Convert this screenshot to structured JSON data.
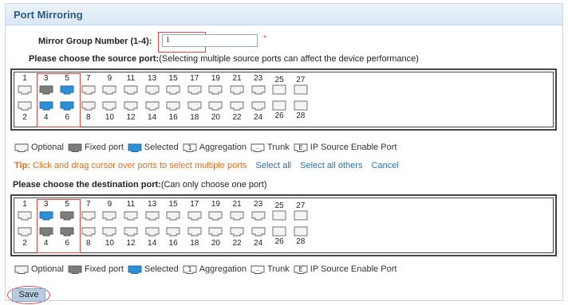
{
  "title": "Port Mirroring",
  "mirror_group": {
    "label": "Mirror Group Number (1-4):",
    "value": "1",
    "required_mark": "*"
  },
  "source": {
    "heading": "Please choose the source port:",
    "note": "(Selecting multiple source ports can affect the device performance)",
    "top_numbers": [
      "1",
      "3",
      "5",
      "7",
      "9",
      "11",
      "13",
      "15",
      "17",
      "19",
      "21",
      "23",
      "25",
      "27"
    ],
    "bottom_numbers": [
      "2",
      "4",
      "6",
      "8",
      "10",
      "12",
      "14",
      "16",
      "18",
      "20",
      "22",
      "24",
      "26",
      "28"
    ],
    "top_states": [
      "optional",
      "fixed",
      "selected",
      "optional",
      "optional",
      "optional",
      "optional",
      "optional",
      "optional",
      "optional",
      "optional",
      "optional",
      "blank",
      "blank"
    ],
    "bottom_states": [
      "optional",
      "selected",
      "selected",
      "optional",
      "optional",
      "optional",
      "optional",
      "optional",
      "optional",
      "optional",
      "optional",
      "optional",
      "blank",
      "blank"
    ]
  },
  "destination": {
    "heading": "Please choose the destination port:",
    "note": "(Can only choose one port)",
    "top_numbers": [
      "1",
      "3",
      "5",
      "7",
      "9",
      "11",
      "13",
      "15",
      "17",
      "19",
      "21",
      "23",
      "25",
      "27"
    ],
    "bottom_numbers": [
      "2",
      "4",
      "6",
      "8",
      "10",
      "12",
      "14",
      "16",
      "18",
      "20",
      "22",
      "24",
      "26",
      "28"
    ],
    "top_states": [
      "optional",
      "selected",
      "fixed",
      "optional",
      "optional",
      "optional",
      "optional",
      "optional",
      "optional",
      "optional",
      "optional",
      "optional",
      "blank",
      "blank"
    ],
    "bottom_states": [
      "optional",
      "fixed",
      "fixed",
      "optional",
      "optional",
      "optional",
      "optional",
      "optional",
      "optional",
      "optional",
      "optional",
      "optional",
      "blank",
      "blank"
    ]
  },
  "legend": {
    "optional": "Optional",
    "fixed": "Fixed port",
    "selected": "Selected",
    "aggregation": "Aggregation",
    "trunk": "Trunk",
    "ip_source": "IP Source Enable Port",
    "aggregation_glyph": "1",
    "trunk_glyph": "...",
    "ip_glyph": "E"
  },
  "tip": {
    "prefix": "Tip:",
    "text": "Click and drag cursor over ports to select multiple ports",
    "select_all": "Select all",
    "select_all_others": "Select all others",
    "cancel": "Cancel"
  },
  "save_label": "Save",
  "colors": {
    "selected": "#2f8fd6",
    "fixed": "#7d7d7d",
    "optional_fill": "#f3f3f3",
    "highlight": "#e24a4a",
    "tip": "#e46c1e",
    "link": "#2a6fb5"
  }
}
